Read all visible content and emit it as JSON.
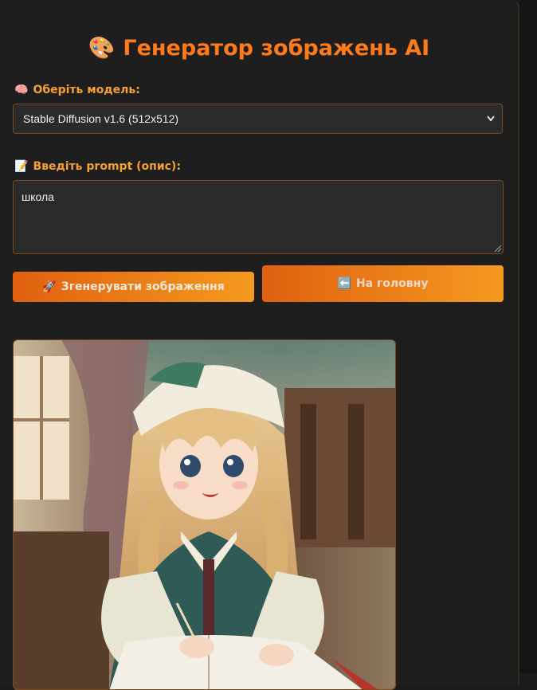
{
  "header": {
    "title_emoji": "🎨",
    "title": "Генератор зображень AI"
  },
  "model": {
    "label_emoji": "🧠",
    "label": "Оберіть модель:",
    "selected": "Stable Diffusion v1.6 (512x512)"
  },
  "prompt": {
    "label_emoji": "📝",
    "label": "Введіть prompt (опис):",
    "value": "школа"
  },
  "actions": {
    "generate_emoji": "🚀",
    "generate_label": "Згенерувати зображення",
    "home_emoji": "⬅️",
    "home_label": "На головну"
  },
  "colors": {
    "accent": "#ff7b1a",
    "label": "#f5a030",
    "border": "#7a4a1a",
    "background": "#1e1e1e"
  }
}
